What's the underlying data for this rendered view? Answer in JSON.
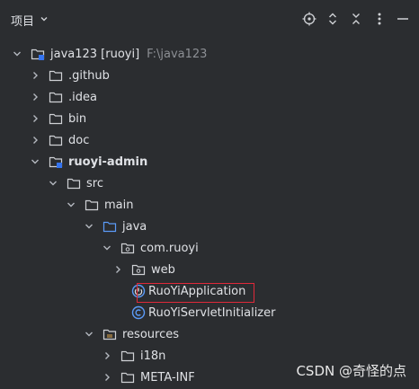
{
  "header": {
    "title": "项目"
  },
  "tree": {
    "root": {
      "label": "java123 [ruoyi]",
      "path": "F:\\java123"
    },
    "github": ".github",
    "idea": ".idea",
    "bin": "bin",
    "doc": "doc",
    "admin": "ruoyi-admin",
    "src": "src",
    "main": "main",
    "java": "java",
    "pkg": "com.ruoyi",
    "web": "web",
    "app": "RuoYiApplication",
    "servlet": "RuoYiServletInitializer",
    "resources": "resources",
    "i18n": "i18n",
    "metainf": "META-INF"
  },
  "watermark": "CSDN @奇怪的点"
}
